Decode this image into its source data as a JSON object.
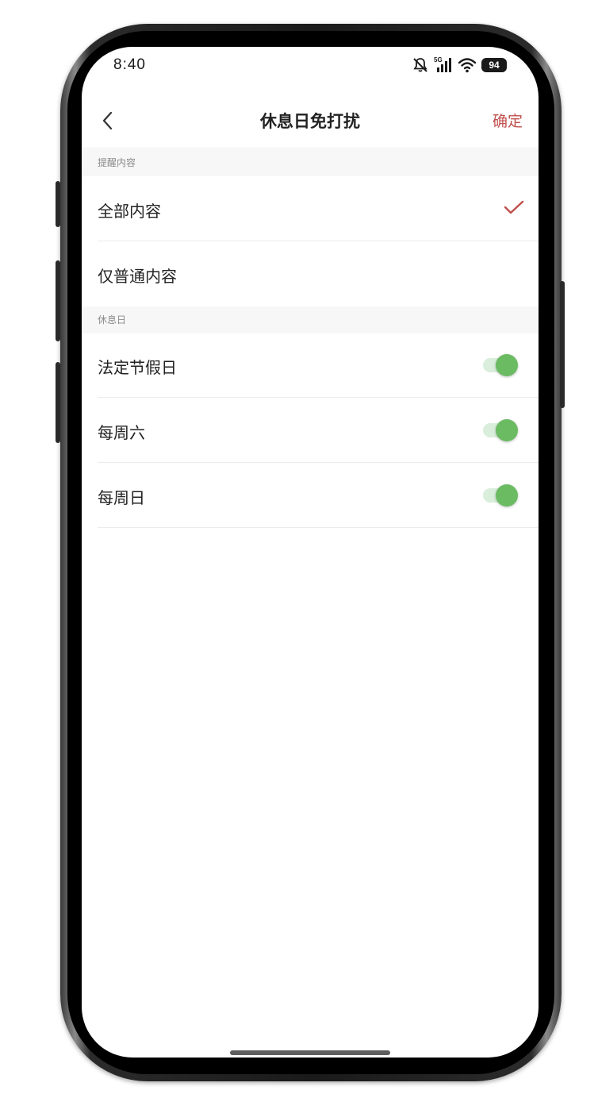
{
  "status_bar": {
    "time": "8:40",
    "network": "5G",
    "battery": "94"
  },
  "nav": {
    "title": "休息日免打扰",
    "confirm": "确定",
    "accent_color": "#c0504d"
  },
  "sections": [
    {
      "header": "提醒内容",
      "items": [
        {
          "label": "全部内容",
          "selected": true
        },
        {
          "label": "仅普通内容",
          "selected": false
        }
      ]
    },
    {
      "header": "休息日",
      "items": [
        {
          "label": "法定节假日",
          "enabled": true
        },
        {
          "label": "每周六",
          "enabled": true
        },
        {
          "label": "每周日",
          "enabled": true
        }
      ]
    }
  ],
  "colors": {
    "toggle_on": "#6bbb62",
    "toggle_track": "#d9eedb",
    "section_bg": "#f7f7f7"
  }
}
